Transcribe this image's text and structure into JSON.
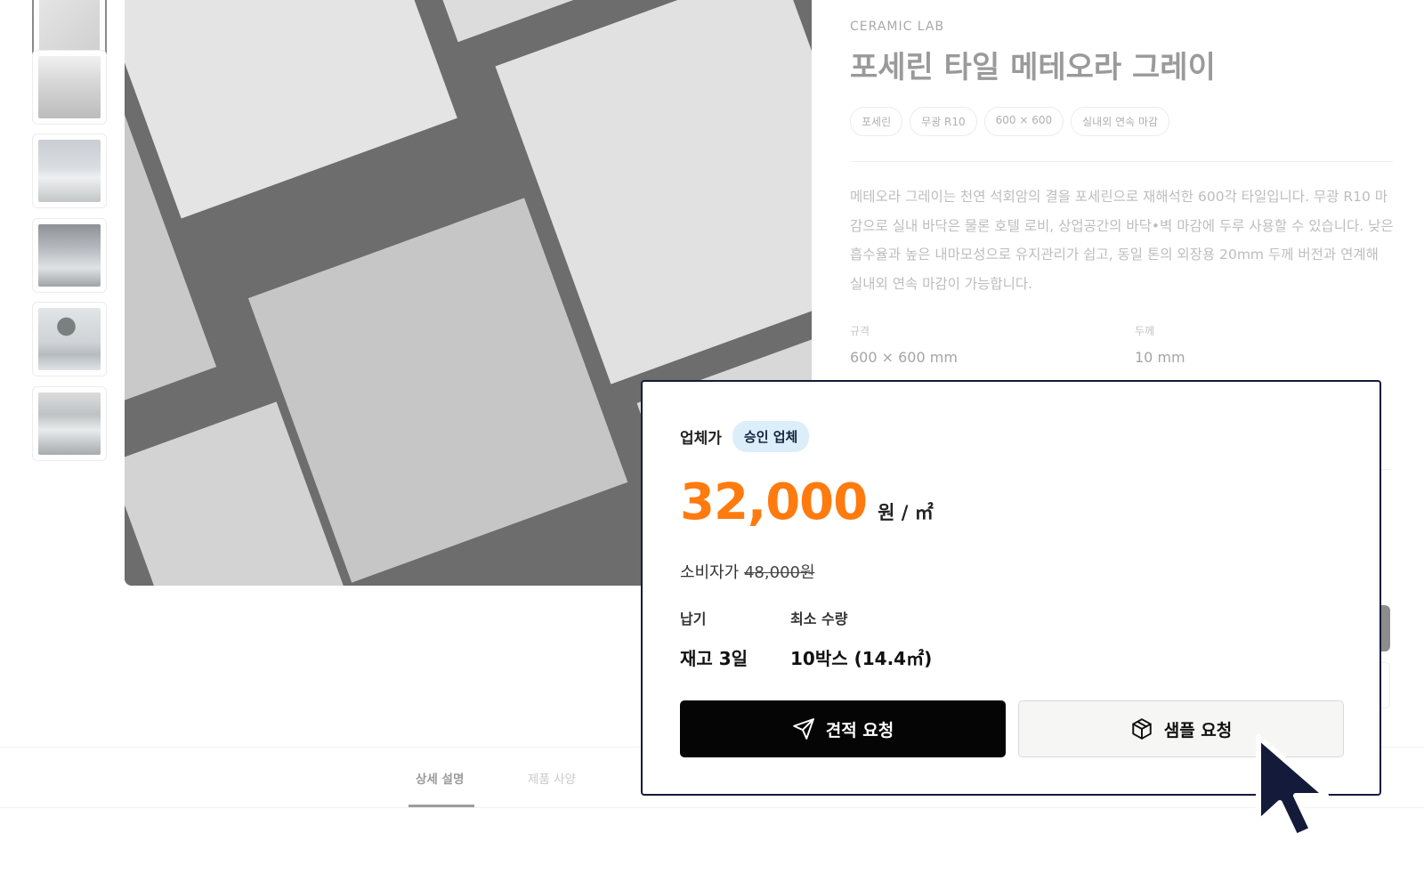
{
  "gallery": {
    "thumbnails": [
      "tile-sample",
      "interior-corridor",
      "beach-resort",
      "hotel-pool-terrace",
      "palm-pool",
      "villa-pool"
    ]
  },
  "product": {
    "brand": "CERAMIC LAB",
    "title": "포세린 타일 메테오라 그레이",
    "chips": [
      "포세린",
      "무광 R10",
      "600 × 600",
      "실내외 연속 마감"
    ],
    "description": "메테오라 그레이는 천연 석회암의 결을 포세린으로 재해석한 600각 타일입니다. 무광 R10 마감으로 실내 바닥은 물론 호텔 로비, 상업공간의 바닥•벽 마감에 두루 사용할 수 있습니다. 낮은 흡수율과 높은 내마모성으로 유지관리가 쉽고, 동일 톤의 외장용 20mm 두께 버전과 연계해 실내외 연속 마감이 가능합니다.",
    "specs": [
      {
        "label": "규격",
        "value": "600 × 600 mm"
      },
      {
        "label": "두께",
        "value": "10 mm"
      }
    ]
  },
  "price_card": {
    "dealer_label": "업체가",
    "badge": "승인 업체",
    "price": "32,000",
    "unit": "원 / ㎡",
    "retail_label": "소비자가",
    "retail_price": "48,000원",
    "lead_time_label": "납기",
    "lead_time_value": "재고 3일",
    "min_qty_label": "최소 수량",
    "min_qty_value": "10박스 (14.4㎡)",
    "quote_button": "견적 요청",
    "sample_button": "샘플 요청"
  },
  "tabs": [
    {
      "label": "상세 설명",
      "active": true
    },
    {
      "label": "제품 사양",
      "active": false
    }
  ],
  "colors": {
    "accent_price": "#ff7a0f",
    "badge_bg": "#ddeefb",
    "card_border": "#141a3a",
    "primary_button": "#050505",
    "cursor": "#141a3a"
  },
  "icons": {
    "quote": "send-icon",
    "sample": "box-icon",
    "pointer": "mouse-cursor-icon"
  }
}
